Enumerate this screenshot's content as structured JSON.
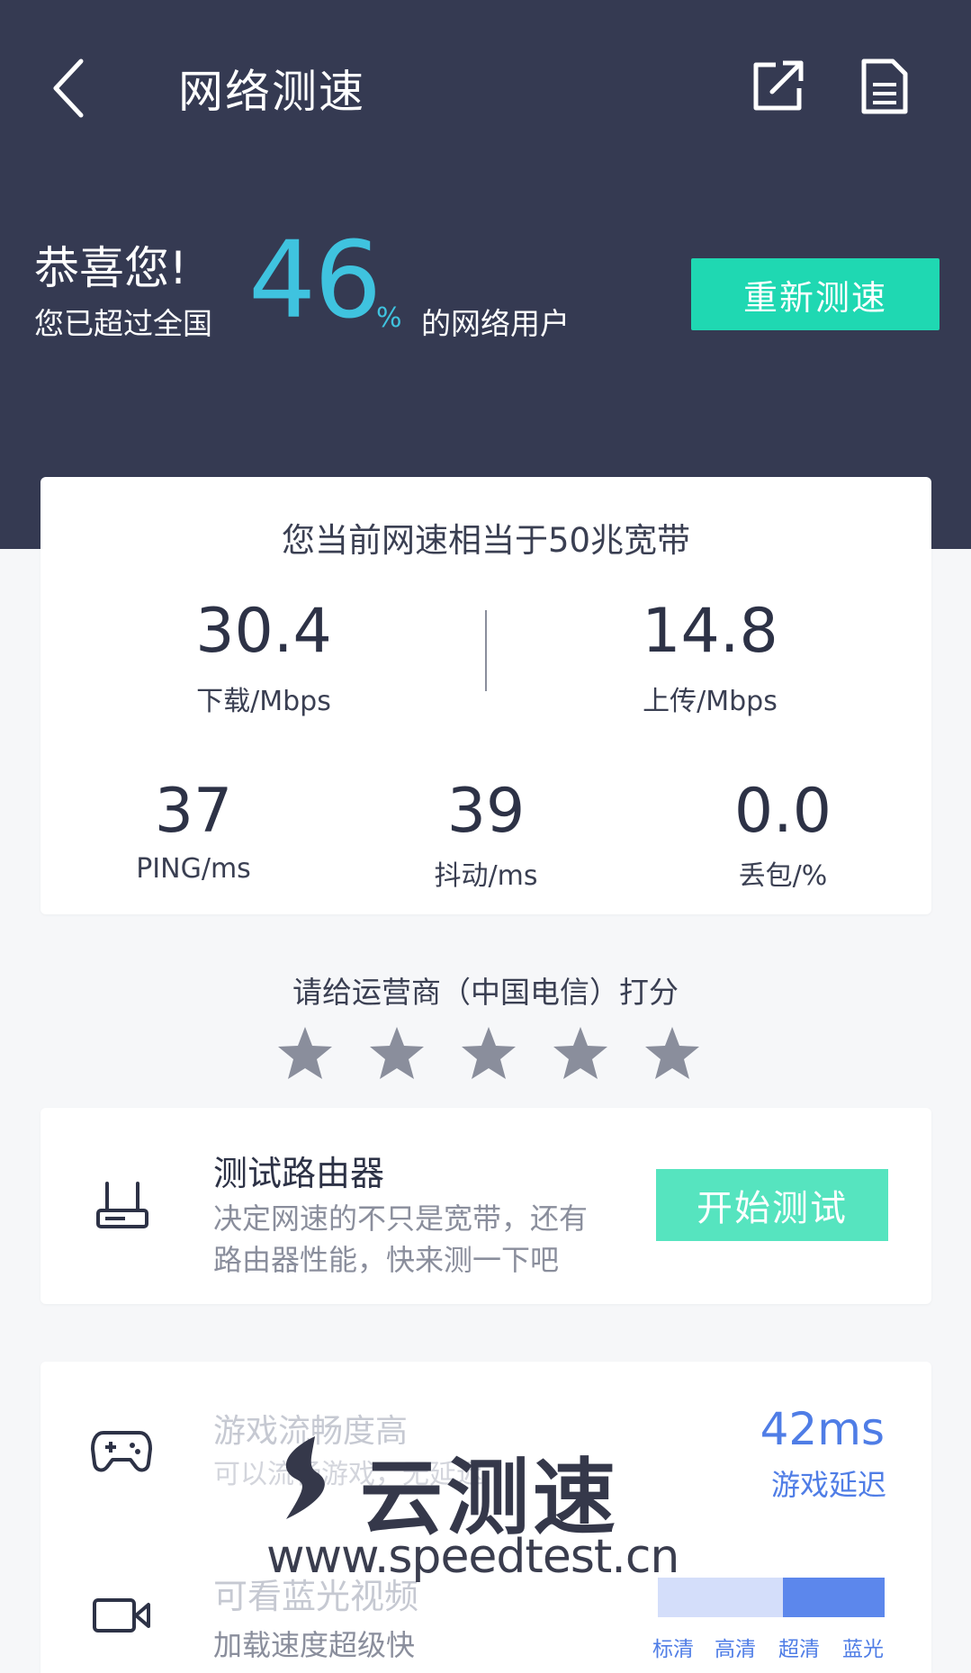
{
  "header": {
    "title": "网络测速",
    "back_icon": "chevron-left-icon",
    "share_icon": "share-icon",
    "report_icon": "document-icon"
  },
  "result": {
    "congrats": "恭喜您!",
    "exceeded_prefix": "您已超过全国",
    "percent": "46",
    "percent_unit": "%",
    "users_suffix": "的网络用户",
    "retest_label": "重新测速"
  },
  "speed": {
    "equivalent": "您当前网速相当于50兆宽带",
    "download": {
      "value": "30.4",
      "label": "下载/Mbps"
    },
    "upload": {
      "value": "14.8",
      "label": "上传/Mbps"
    },
    "ping": {
      "value": "37",
      "label": "PING/ms"
    },
    "jitter": {
      "value": "39",
      "label": "抖动/ms"
    },
    "loss": {
      "value": "0.0",
      "label": "丢包/%"
    }
  },
  "rating": {
    "prompt": "请给运营商（中国电信）打分",
    "stars": 5,
    "selected": 0
  },
  "router": {
    "title": "测试路由器",
    "desc_line1": "决定网速的不只是宽带，还有",
    "desc_line2": "路由器性能，快来测一下吧",
    "button": "开始测试"
  },
  "experience": {
    "game": {
      "title": "游戏流畅度高",
      "desc": "可以流畅游戏，无延迟",
      "latency": "42ms",
      "latency_label": "游戏延迟"
    },
    "video": {
      "title": "可看蓝光视频",
      "desc": "加载速度超级快",
      "qualities": [
        "标清",
        "高清",
        "超清",
        "蓝光"
      ],
      "level": 0.55
    }
  },
  "watermark": {
    "brand": "云测速",
    "url": "www.speedtest.cn"
  },
  "colors": {
    "header_bg": "#353a52",
    "accent_cyan": "#3fc3df",
    "retest_green": "#1fd8b2",
    "start_green": "#56e4bf",
    "blue": "#4f7de6",
    "star_gray": "#8a8e9c"
  }
}
